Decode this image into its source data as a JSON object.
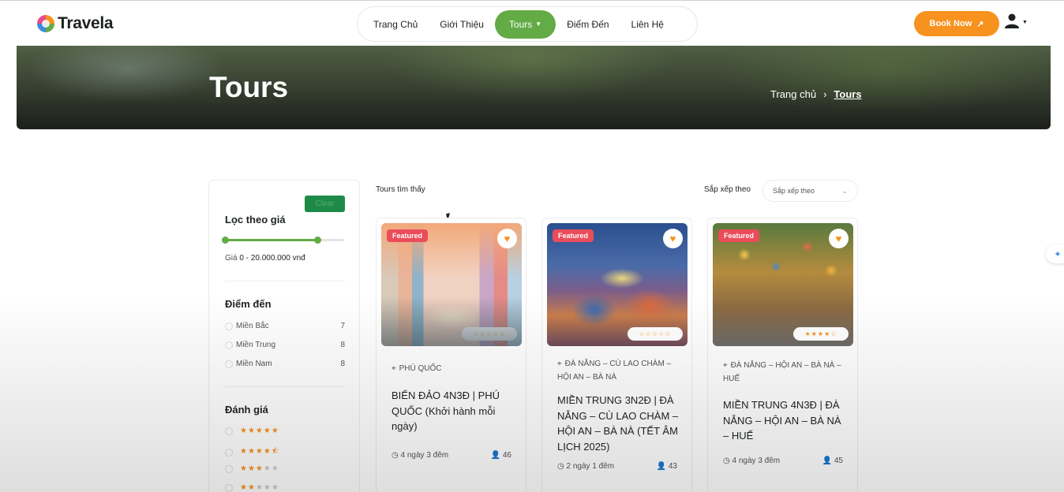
{
  "brand": {
    "name": "Travela"
  },
  "nav": {
    "items": [
      {
        "label": "Trang Chủ"
      },
      {
        "label": "Giới Thiệu"
      },
      {
        "label": "Tours",
        "active": true
      },
      {
        "label": "Điểm Đến"
      },
      {
        "label": "Liên Hệ"
      }
    ],
    "book_label": "Book Now"
  },
  "banner": {
    "title": "Tours",
    "breadcrumb": {
      "home": "Trang chủ",
      "current": "Tours"
    }
  },
  "sidebar": {
    "clear_label": "Clear",
    "price_heading": "Lọc theo giá",
    "price_label": "Giá",
    "price_range": "0 - 20.000.000 vnđ",
    "price_slider": {
      "min_fraction": 0,
      "max_fraction": 0.78
    },
    "destination_heading": "Điểm đến",
    "destinations": [
      {
        "label": "Miền Bắc",
        "count": "7"
      },
      {
        "label": "Miền Trung",
        "count": "8"
      },
      {
        "label": "Miền Nam",
        "count": "8"
      }
    ],
    "rating_heading": "Đánh giá",
    "rating_options": [
      {
        "stars": "★★★★★"
      },
      {
        "stars": "★★★★⯪"
      },
      {
        "stars": "★★★★★"
      },
      {
        "stars": "★★★★★"
      }
    ]
  },
  "toolbar": {
    "found_label": "Tours tìm thấy",
    "sort_label": "Sắp xếp theo",
    "sort_selected": "Sắp xếp theo"
  },
  "tours": [
    {
      "badge": "Featured",
      "location": "PHÚ QUỐC",
      "title": "BIỂN ĐẢO 4N3Đ | PHÚ QUỐC (Khởi hành mỗi ngày)",
      "duration": "4 ngày 3 đêm",
      "people": "46",
      "stars": "☆☆☆☆☆"
    },
    {
      "badge": "Featured",
      "location": "ĐÀ NẴNG – CÙ LAO CHÀM – HỘI AN – BÀ NÀ",
      "title": "MIỀN TRUNG 3N2Đ | ĐÀ NẴNG – CÙ LAO CHÀM – HỘI AN – BÀ NÀ (TẾT ÂM LỊCH 2025)",
      "duration": "2 ngày 1 đêm",
      "people": "43",
      "stars": "☆☆☆☆☆"
    },
    {
      "badge": "Featured",
      "location": "ĐÀ NẴNG – HỘI AN – BÀ NÀ – HUẾ",
      "title": "MIỀN TRUNG 4N3Đ | ĐÀ NẴNG – HỘI AN – BÀ NÀ – HUẾ",
      "duration": "4 ngày 3 đêm",
      "people": "45",
      "stars": "★★★★☆"
    }
  ],
  "colors": {
    "brand_green": "#63ab45",
    "accent_orange": "#f7921e",
    "featured_red": "#ea4c5a",
    "clear_green": "#1e8a48"
  },
  "icons": [
    "user-icon",
    "arrow-up-right-icon",
    "heart-icon",
    "map-pin-icon",
    "clock-icon",
    "people-icon",
    "chevron-right-icon",
    "chevron-down-icon"
  ]
}
